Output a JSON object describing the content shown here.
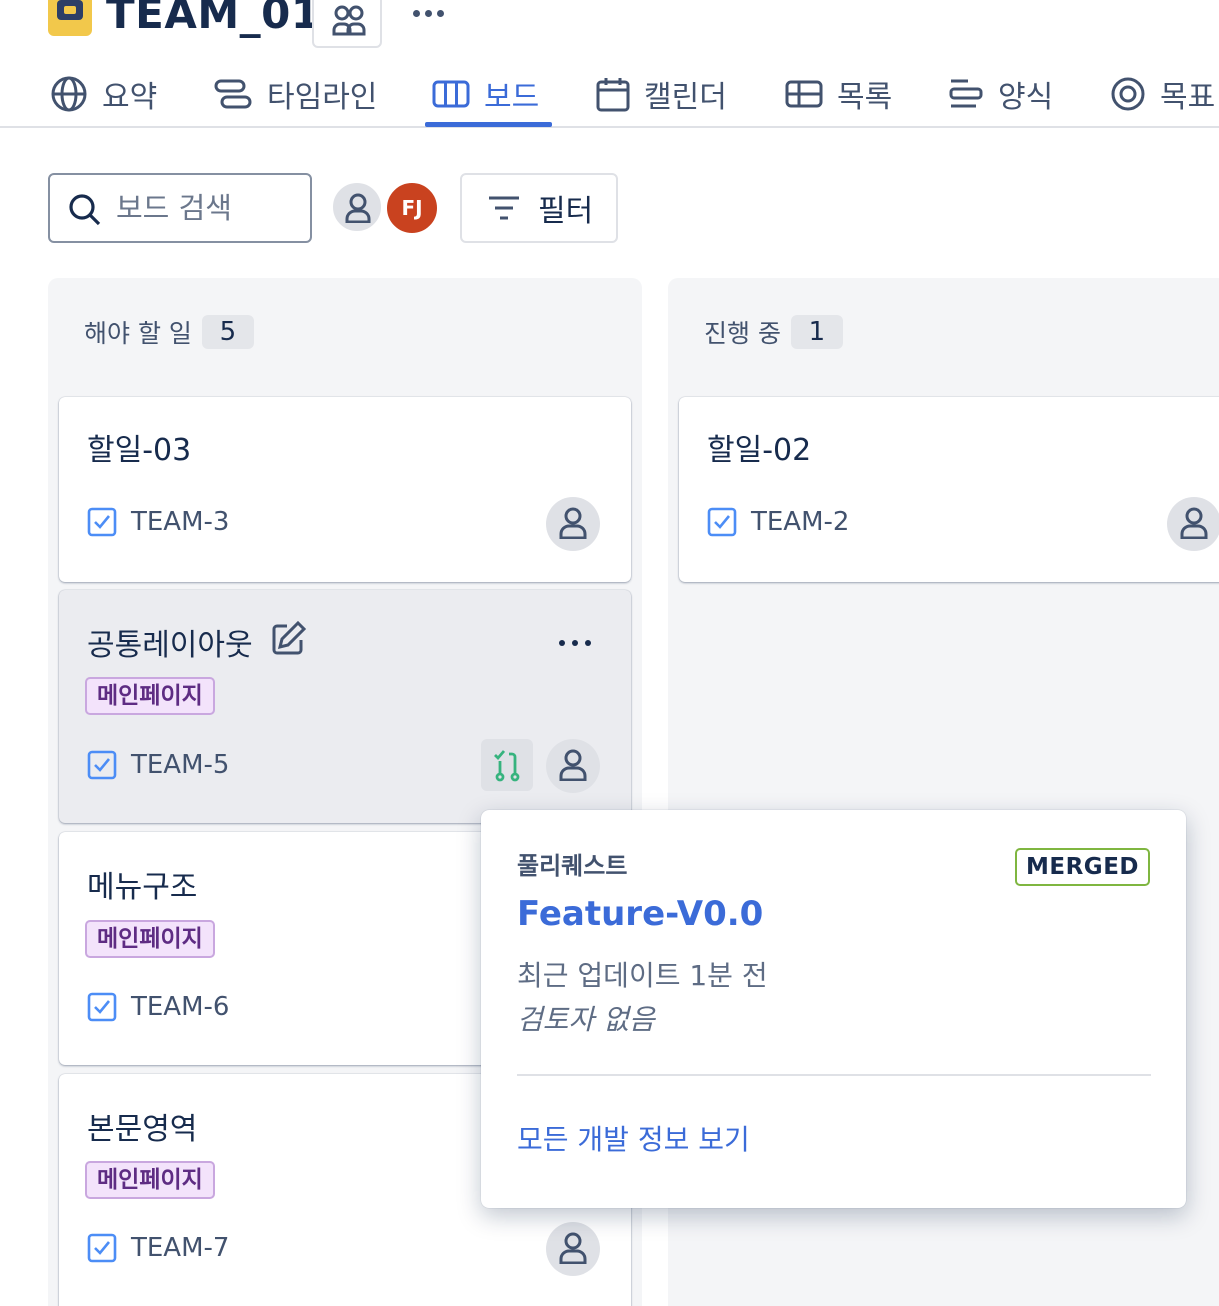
{
  "header": {
    "project_title": "TEAM_01"
  },
  "tabs": [
    {
      "label": "요약",
      "icon": "globe-icon"
    },
    {
      "label": "타임라인",
      "icon": "timeline-icon"
    },
    {
      "label": "보드",
      "icon": "board-icon",
      "active": true
    },
    {
      "label": "캘린더",
      "icon": "calendar-icon"
    },
    {
      "label": "목록",
      "icon": "list-icon"
    },
    {
      "label": "양식",
      "icon": "form-icon"
    },
    {
      "label": "목표",
      "icon": "goal-icon"
    }
  ],
  "toolbar": {
    "search_placeholder": "보드 검색",
    "avatar_initials": "FJ",
    "filter_label": "필터"
  },
  "columns": [
    {
      "title": "해야 할 일",
      "count": "5",
      "cards": [
        {
          "title": "할일-03",
          "key": "TEAM-3"
        },
        {
          "title": "공통레이아웃",
          "label": "메인페이지",
          "key": "TEAM-5"
        },
        {
          "title": "메뉴구조",
          "label": "메인페이지",
          "key": "TEAM-6"
        },
        {
          "title": "본문영역",
          "label": "메인페이지",
          "key": "TEAM-7"
        }
      ]
    },
    {
      "title": "진행 중",
      "count": "1",
      "cards": [
        {
          "title": "할일-02",
          "key": "TEAM-2"
        }
      ]
    }
  ],
  "popover": {
    "section_label": "풀리퀘스트",
    "status_badge": "MERGED",
    "pr_title": "Feature-V0.0",
    "updated": "최근 업데이트 1분 전",
    "reviewers": "검토자 없음",
    "link": "모든 개발 정보 보기"
  },
  "colors": {
    "accent": "#3b6bd8",
    "label_bg": "#f3e3fb",
    "merged_border": "#7fb640",
    "avatar_fj": "#c9421f"
  }
}
